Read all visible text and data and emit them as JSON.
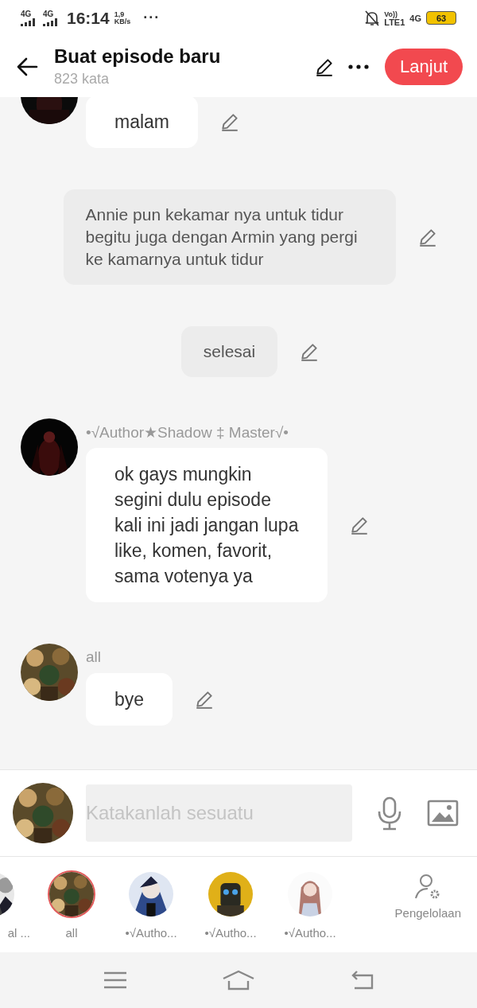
{
  "status_bar": {
    "signal_1": "4G",
    "signal_2": "4G",
    "time": "16:14",
    "speed_value": "1,9",
    "speed_unit": "KB/s",
    "more": "···",
    "volte": "Vo))",
    "lte": "LTE1",
    "network": "4G",
    "battery": "63"
  },
  "header": {
    "title": "Buat episode baru",
    "subtitle": "823 kata",
    "next_button": "Lanjut"
  },
  "messages": [
    {
      "kind": "dialogue",
      "text": "malam"
    },
    {
      "kind": "narration",
      "text": "Annie pun kekamar nya untuk tidur begitu juga dengan Armin yang pergi ke kamarnya untuk tidur"
    },
    {
      "kind": "narration",
      "text": "selesai"
    },
    {
      "kind": "dialogue",
      "name": "•√Author★Shadow ‡ Master√•",
      "text": "ok gays mungkin segini dulu episode kali ini jadi jangan lupa like, komen, favorit, sama votenya ya"
    },
    {
      "kind": "dialogue",
      "name": "all",
      "text": "bye"
    }
  ],
  "composer": {
    "placeholder": "Katakanlah sesuatu"
  },
  "characters": [
    {
      "name": "al ...",
      "selected": false
    },
    {
      "name": "all",
      "selected": true
    },
    {
      "name": "•√Autho...",
      "selected": false
    },
    {
      "name": "•√Autho...",
      "selected": false
    },
    {
      "name": "•√Autho...",
      "selected": false
    }
  ],
  "manage_label": "Pengelolaan"
}
